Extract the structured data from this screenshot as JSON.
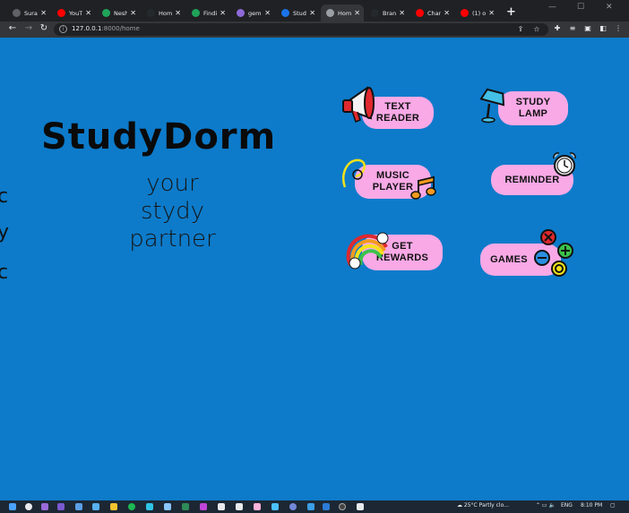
{
  "browser": {
    "tabs": [
      {
        "label": "Sura",
        "favicon": "globe-icon",
        "color": "#5f6368",
        "active": false
      },
      {
        "label": "YouT",
        "favicon": "youtube-icon",
        "color": "#ff0000",
        "active": false
      },
      {
        "label": "Nesh",
        "favicon": "film-icon",
        "color": "#20a45a",
        "active": false
      },
      {
        "label": "Hom",
        "favicon": "github-icon",
        "color": "#24292e",
        "active": false
      },
      {
        "label": "Findi",
        "favicon": "film-icon",
        "color": "#20a45a",
        "active": false
      },
      {
        "label": "gem",
        "favicon": "gemini-icon",
        "color": "#8e6ad8",
        "active": false
      },
      {
        "label": "Study",
        "favicon": "doc-icon",
        "color": "#1a73e8",
        "active": false
      },
      {
        "label": "Hom",
        "favicon": "globe-icon",
        "color": "#9aa0a6",
        "active": true
      },
      {
        "label": "Bran",
        "favicon": "github-icon",
        "color": "#24292e",
        "active": false
      },
      {
        "label": "Chan",
        "favicon": "youtube-icon",
        "color": "#ff0000",
        "active": false
      },
      {
        "label": "(1) o",
        "favicon": "youtube-icon",
        "color": "#ff0000",
        "active": false
      }
    ],
    "new_tab": "+",
    "url_host": "127.0.0.1",
    "url_path": ":8000/home"
  },
  "page": {
    "brand": "StudyDorm",
    "tagline_lines": [
      "your",
      "stydy",
      "partner"
    ],
    "features": [
      {
        "lines": [
          "TEXT",
          "READER"
        ],
        "icon": "megaphone-icon"
      },
      {
        "lines": [
          "STUDY",
          "LAMP"
        ],
        "icon": "lamp-icon"
      },
      {
        "lines": [
          "MUSIC",
          "PLAYER"
        ],
        "icon": "music-note-icon"
      },
      {
        "lines": [
          "REMINDER"
        ],
        "icon": "alarm-clock-icon"
      },
      {
        "lines": [
          "GET",
          "REWARDS"
        ],
        "icon": "rainbow-icon"
      },
      {
        "lines": [
          "GAMES"
        ],
        "icon": "gamepad-buttons-icon"
      }
    ],
    "background": "#0d7bca",
    "pill_color": "#f8a9e6"
  },
  "taskbar": {
    "weather": "25°C  Partly clo...",
    "lang": "ENG",
    "time": "8:10 PM"
  }
}
